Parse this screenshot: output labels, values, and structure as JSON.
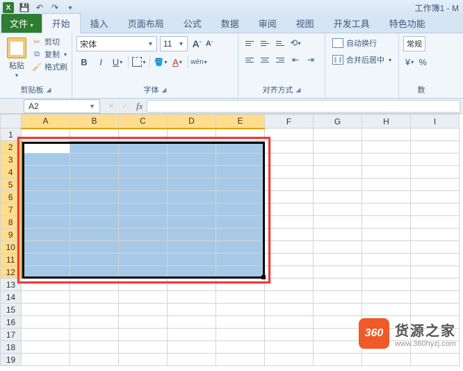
{
  "app": {
    "title": "工作簿1 - M",
    "icon_letter": "X"
  },
  "qat": {
    "save": "save-icon",
    "undo": "undo-icon",
    "redo": "redo-icon"
  },
  "tabs": {
    "file": "文件",
    "items": [
      "开始",
      "插入",
      "页面布局",
      "公式",
      "数据",
      "审阅",
      "视图",
      "开发工具",
      "特色功能"
    ],
    "active_index": 0
  },
  "ribbon": {
    "clipboard": {
      "paste": "粘贴",
      "cut": "剪切",
      "copy": "复制",
      "format_painter": "格式刷",
      "group_label": "剪贴板"
    },
    "font": {
      "name": "宋体",
      "size": "11",
      "increase": "A",
      "decrease": "A",
      "bold": "B",
      "italic": "I",
      "underline": "U",
      "group_label": "字体"
    },
    "alignment": {
      "group_label": "对齐方式"
    },
    "wrap": {
      "wrap_text": "自动换行",
      "merge_center": "合并后居中"
    },
    "number": {
      "format": "常规",
      "group_label": "数"
    }
  },
  "namebox": {
    "ref": "A2"
  },
  "fx": {
    "label": "fx"
  },
  "grid": {
    "columns": [
      "A",
      "B",
      "C",
      "D",
      "E",
      "F",
      "G",
      "H",
      "I"
    ],
    "rows": [
      "1",
      "2",
      "3",
      "4",
      "5",
      "6",
      "7",
      "8",
      "9",
      "10",
      "11",
      "12",
      "13",
      "14",
      "15",
      "16",
      "17",
      "18",
      "19"
    ],
    "selection": {
      "from": "A2",
      "to": "E12"
    },
    "active_cell": "A2",
    "selected_cols": [
      "A",
      "B",
      "C",
      "D",
      "E"
    ],
    "selected_rows": [
      "2",
      "3",
      "4",
      "5",
      "6",
      "7",
      "8",
      "9",
      "10",
      "11",
      "12"
    ]
  },
  "watermark": {
    "badge": "360",
    "text": "货源之家",
    "url": "www.360hyzj.com"
  }
}
